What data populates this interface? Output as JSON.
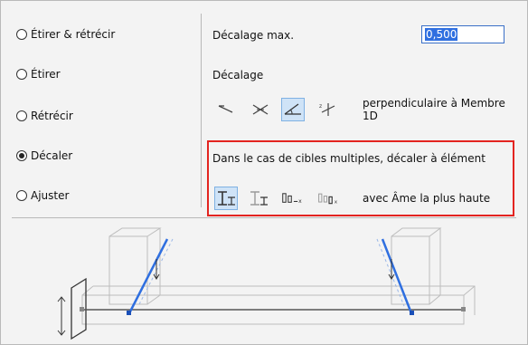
{
  "options": [
    {
      "label": "Étirer & rétrécir",
      "checked": false
    },
    {
      "label": "Étirer",
      "checked": false
    },
    {
      "label": "Rétrécir",
      "checked": false
    },
    {
      "label": "Décaler",
      "checked": true
    },
    {
      "label": "Ajuster",
      "checked": false
    }
  ],
  "max_offset": {
    "label": "Décalage max.",
    "value": "0,500"
  },
  "offset": {
    "label": "Décalage",
    "mode_text": "perpendiculaire à Membre 1D"
  },
  "multi_target": {
    "label": "Dans le cas de cibles multiples, décaler à élément",
    "mode_text": "avec Âme la plus haute"
  },
  "colors": {
    "accent": "#2f6fe0",
    "highlight_box": "#e32420",
    "preview_beam": "#2f6fe0"
  }
}
